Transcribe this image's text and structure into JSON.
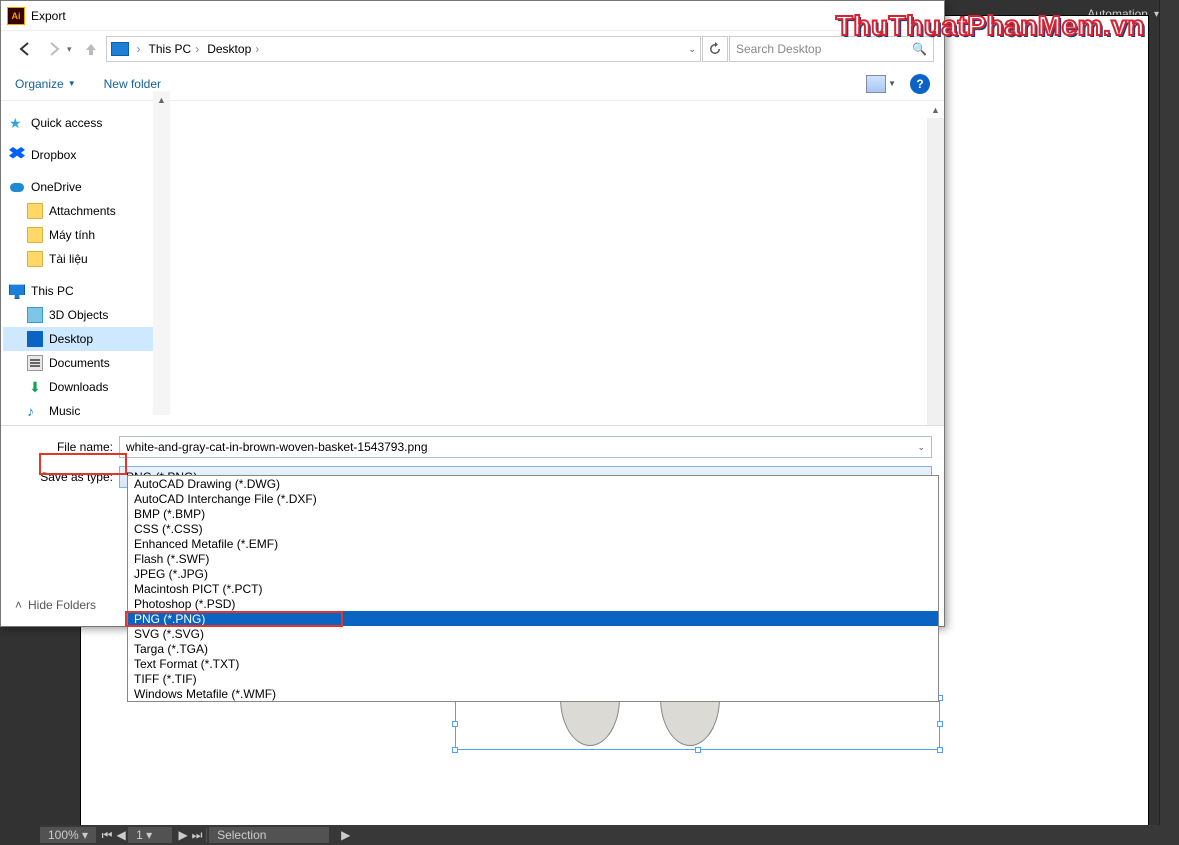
{
  "watermark": "ThuThuatPhanMem.vn",
  "app": {
    "automation_label": "Automation"
  },
  "dialog_title": "Export",
  "breadcrumbs": [
    "This PC",
    "Desktop"
  ],
  "search_placeholder": "Search Desktop",
  "toolbar": {
    "organize": "Organize",
    "new_folder": "New folder"
  },
  "tree": {
    "quick_access": "Quick access",
    "dropbox": "Dropbox",
    "onedrive": "OneDrive",
    "onedrive_children": [
      "Attachments",
      "Máy tính",
      "Tài liệu"
    ],
    "this_pc": "This PC",
    "this_pc_children": [
      "3D Objects",
      "Desktop",
      "Documents",
      "Downloads",
      "Music"
    ]
  },
  "fields": {
    "file_name_label": "File name:",
    "file_name_value": "white-and-gray-cat-in-brown-woven-basket-1543793.png",
    "save_type_label": "Save as type:",
    "save_type_value": "PNG (*.PNG)"
  },
  "type_options": [
    "AutoCAD Drawing (*.DWG)",
    "AutoCAD Interchange File (*.DXF)",
    "BMP (*.BMP)",
    "CSS (*.CSS)",
    "Enhanced Metafile (*.EMF)",
    "Flash (*.SWF)",
    "JPEG (*.JPG)",
    "Macintosh PICT (*.PCT)",
    "Photoshop (*.PSD)",
    "PNG (*.PNG)",
    "SVG (*.SVG)",
    "Targa (*.TGA)",
    "Text Format (*.TXT)",
    "TIFF (*.TIF)",
    "Windows Metafile (*.WMF)"
  ],
  "selected_type_index": 9,
  "hide_folders": "Hide Folders",
  "status": {
    "zoom": "100%",
    "mode": "Selection"
  }
}
